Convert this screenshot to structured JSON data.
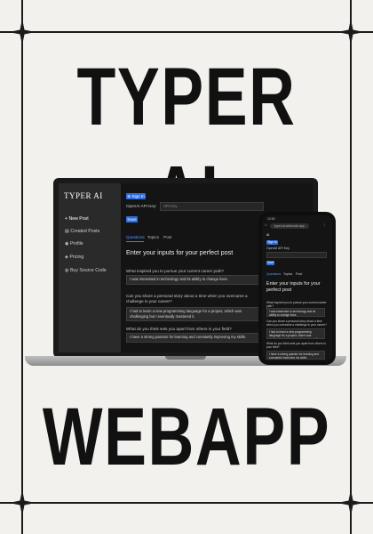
{
  "poster": {
    "title_top": "TYPER AI",
    "title_bottom": "WEBAPP"
  },
  "app": {
    "brand": "TYPER AI",
    "sidebar": [
      {
        "icon": "plus-icon",
        "label": "+ New Post"
      },
      {
        "icon": "list-icon",
        "label": "Created Posts"
      },
      {
        "icon": "user-icon",
        "label": "Profile"
      },
      {
        "icon": "tag-icon",
        "label": "Pricing"
      },
      {
        "icon": "cart-icon",
        "label": "Buy Source Code"
      }
    ],
    "signin_label": "Sign In",
    "api_key_label": "OpenAI API Key:",
    "api_key_placeholder": "API Key",
    "save_label": "Save",
    "tabs": [
      "Questions",
      "Topics",
      "Post"
    ],
    "heading": "Enter your inputs for your perfect post",
    "questions": [
      {
        "q": "What inspired you to pursue your current career path?",
        "a": "I was interested in technology and its ability to change lives."
      },
      {
        "q": "Can you share a personal story about a time when you overcame a challenge in your career?",
        "a": "I had to learn a new programming language for a project, which was challenging but I eventually mastered it."
      },
      {
        "q": "What do you think sets you apart from others in your field?",
        "a": "I have a strong passion for learning and constantly improving my skills."
      }
    ]
  },
  "phone": {
    "url": "typer-ai.webnode.app",
    "time": "12:00",
    "brand": "AI",
    "api_key_label": "OpenAI API Key",
    "heading": "Enter your inputs for your perfect post",
    "q1": "What inspired you to pursue your current career path?",
    "a1": "I was interested in technology and its ability to change lives.",
    "q2": "Can you share a personal story about a time when you overcame a challenge in your career?",
    "a2": "I had to learn a new programming language for a project, which was challenging but I eventually mastered it.",
    "q3": "What do you think sets you apart from others in your field?",
    "a3": "I have a strong passion for learning and constantly improving my skills."
  }
}
